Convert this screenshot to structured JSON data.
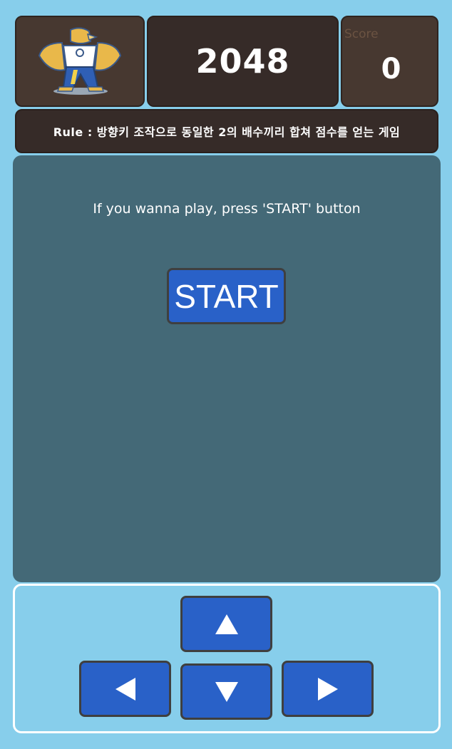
{
  "header": {
    "logo_alt": "mascot",
    "title": "2048",
    "score_label": "Score",
    "score_value": "0"
  },
  "rule": {
    "text": "Rule : 방향키 조작으로 동일한 2의 배수끼리 합쳐 점수를 얻는 게임"
  },
  "board": {
    "message": "If you wanna play, press 'START' button",
    "start_label": "START"
  },
  "controls": {
    "up_icon": "triangle-up-icon",
    "left_icon": "triangle-left-icon",
    "down_icon": "triangle-down-icon",
    "right_icon": "triangle-right-icon"
  },
  "colors": {
    "background": "#87ceeb",
    "panel_brown": "#473830",
    "panel_dark": "#362b28",
    "board": "#446977",
    "button_blue": "#2961c8"
  }
}
